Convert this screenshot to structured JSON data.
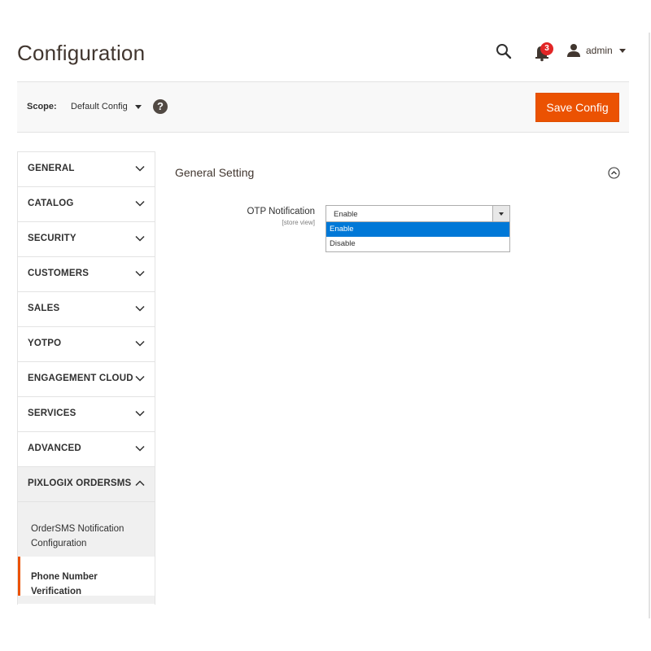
{
  "header": {
    "title": "Configuration",
    "notifications_count": "3",
    "username": "admin"
  },
  "scope": {
    "label": "Scope:",
    "value": "Default Config",
    "save_label": "Save Config"
  },
  "sidebar": {
    "tabs": [
      {
        "label": "GENERAL"
      },
      {
        "label": "CATALOG"
      },
      {
        "label": "SECURITY"
      },
      {
        "label": "CUSTOMERS"
      },
      {
        "label": "SALES"
      },
      {
        "label": "YOTPO"
      },
      {
        "label": "ENGAGEMENT CLOUD"
      },
      {
        "label": "SERVICES"
      },
      {
        "label": "ADVANCED"
      },
      {
        "label": "PIXLOGIX ORDERSMS"
      }
    ],
    "subitems": [
      {
        "label": "OrderSMS Notification Configuration"
      },
      {
        "label": "Phone Number Verification"
      }
    ]
  },
  "main": {
    "section_title": "General Setting",
    "field": {
      "label": "OTP Notification",
      "scope": "[store view]",
      "value": "Enable",
      "options": [
        {
          "label": "Enable"
        },
        {
          "label": "Disable"
        }
      ]
    }
  },
  "colors": {
    "accent": "#eb5202",
    "badge": "#e22626",
    "selected_option": "#0078d7"
  }
}
